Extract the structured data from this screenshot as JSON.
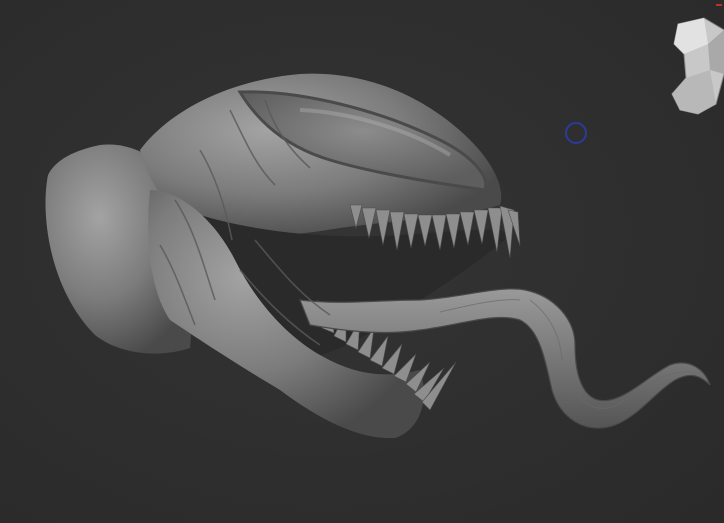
{
  "viewport": {
    "background_color": "#2f2f2f",
    "model_color": "#8a8a8a"
  },
  "icons": {
    "navigation_gizmo": "head-gizmo-icon",
    "brush_cursor": "brush-cursor-icon",
    "axis_marker": "axis-marker-icon"
  },
  "colors": {
    "brush_cursor": "#2c3a9a",
    "axis_marker": "#c0302a"
  }
}
